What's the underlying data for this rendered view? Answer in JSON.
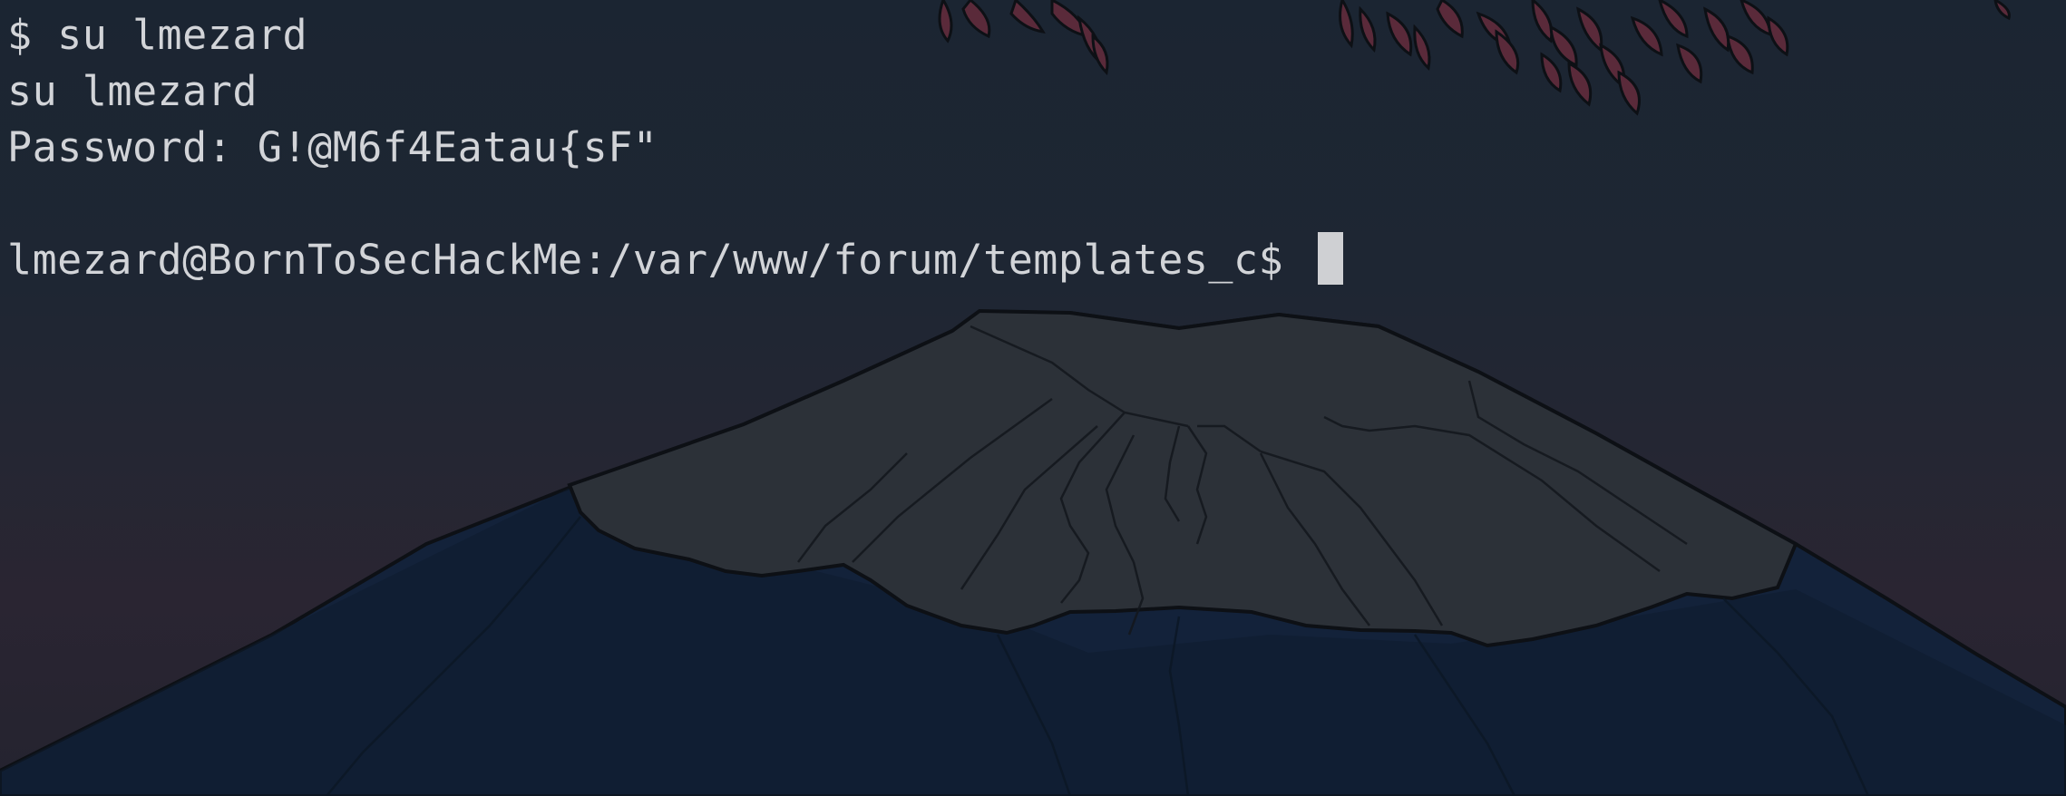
{
  "terminal": {
    "lines": [
      "$ su lmezard",
      "su lmezard",
      "Password: G!@M6f4Eatau{sF\"",
      "",
      "lmezard@BornToSecHackMe:/var/www/forum/templates_c$ "
    ]
  },
  "wallpaper": {
    "subject": "mountain-with-red-leaves",
    "colors": {
      "sky_top": "#1b2532",
      "sky_bottom": "#2a2532",
      "snow_cap": "#2c3138",
      "mountain_body": "#13223a",
      "mountain_dark": "#0e1c2e",
      "leaves": "#5a2a3a",
      "leaf_outline": "#0d1015",
      "text": "#d2d4d8",
      "cursor": "#cfd0d3"
    }
  }
}
